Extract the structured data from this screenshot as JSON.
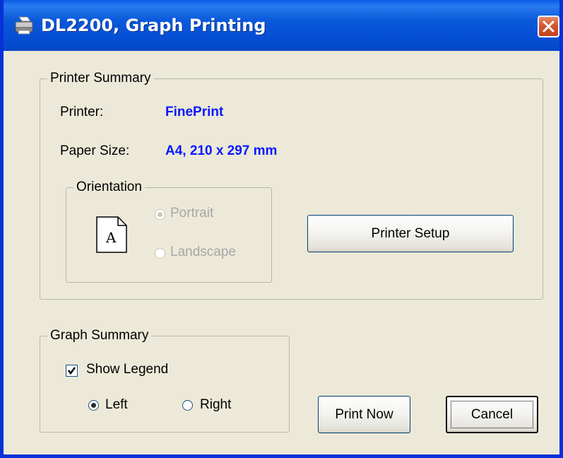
{
  "window": {
    "title": "DL2200, Graph Printing"
  },
  "printer_summary": {
    "legend": "Printer Summary",
    "printer_label": "Printer:",
    "printer_value": "FinePrint",
    "paper_label": "Paper Size:",
    "paper_value": "A4, 210 x 297 mm",
    "orientation": {
      "legend": "Orientation",
      "icon_letter": "A",
      "portrait_label": "Portrait",
      "landscape_label": "Landscape",
      "selected": "Portrait",
      "enabled": false
    },
    "printer_setup_label": "Printer Setup"
  },
  "graph_summary": {
    "legend": "Graph Summary",
    "show_legend_label": "Show Legend",
    "show_legend_checked": true,
    "left_label": "Left",
    "right_label": "Right",
    "selected": "Left"
  },
  "buttons": {
    "print_now": "Print Now",
    "cancel": "Cancel"
  },
  "colors": {
    "value_text": "#0a19ff",
    "titlebar": "#0a59d9",
    "dialog_bg": "#ece9d8"
  }
}
